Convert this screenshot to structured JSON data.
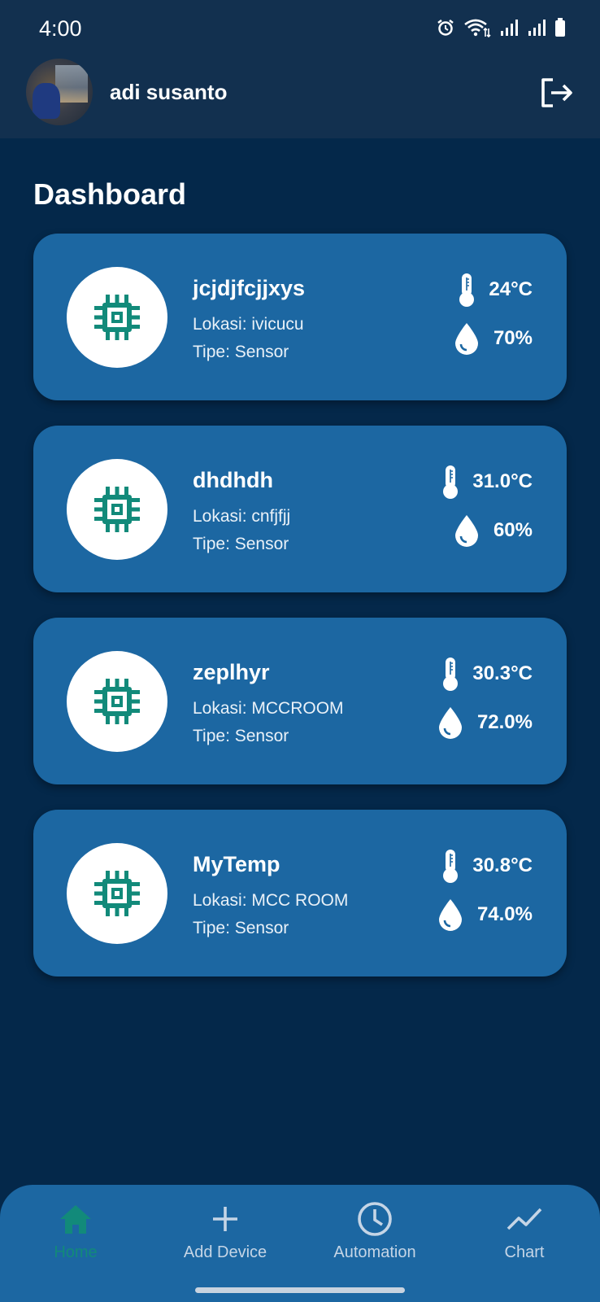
{
  "status": {
    "time": "4:00"
  },
  "header": {
    "user_name": "adi susanto"
  },
  "page": {
    "title": "Dashboard"
  },
  "devices": [
    {
      "name": "jcjdjfcjjxys",
      "location": "Lokasi: ivicucu",
      "type": "Tipe: Sensor",
      "temperature": "24°C",
      "humidity": "70%"
    },
    {
      "name": "dhdhdh",
      "location": "Lokasi: cnfjfjj",
      "type": "Tipe: Sensor",
      "temperature": "31.0°C",
      "humidity": "60%"
    },
    {
      "name": "zeplhyr",
      "location": "Lokasi: MCCROOM",
      "type": "Tipe: Sensor",
      "temperature": "30.3°C",
      "humidity": "72.0%"
    },
    {
      "name": "MyTemp",
      "location": "Lokasi: MCC ROOM",
      "type": "Tipe: Sensor",
      "temperature": "30.8°C",
      "humidity": "74.0%"
    }
  ],
  "nav": {
    "items": [
      {
        "label": "Home",
        "icon": "home-icon"
      },
      {
        "label": "Add Device",
        "icon": "plus-icon"
      },
      {
        "label": "Automation",
        "icon": "clock-icon"
      },
      {
        "label": "Chart",
        "icon": "trend-icon"
      }
    ],
    "active": "Home"
  },
  "colors": {
    "background": "#04284a",
    "appbar": "#12304f",
    "card": "#1c67a2",
    "accent": "#128a7a"
  }
}
